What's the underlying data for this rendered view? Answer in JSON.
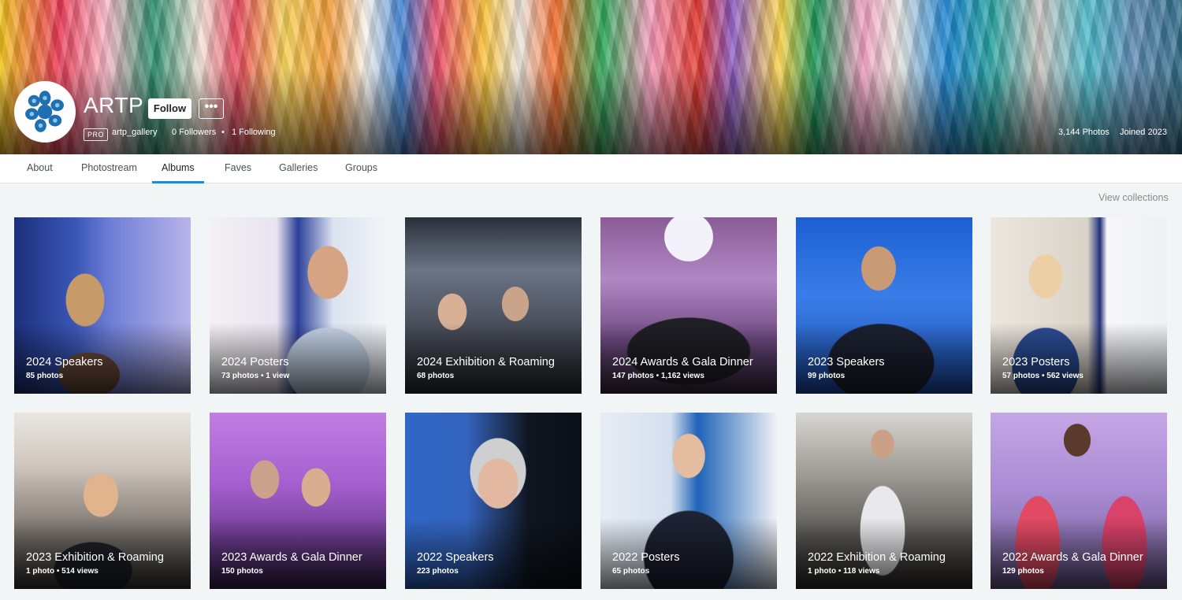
{
  "profile": {
    "name": "ARTP",
    "follow_label": "Follow",
    "more_label": "•••",
    "badge": "PRO",
    "username": "artp_gallery",
    "followers": "0 Followers",
    "separator": "•",
    "following": "1 Following",
    "photos_count": "3,144 Photos",
    "joined": "Joined 2023"
  },
  "tabs": [
    {
      "label": "About"
    },
    {
      "label": "Photostream"
    },
    {
      "label": "Albums",
      "active": true
    },
    {
      "label": "Faves"
    },
    {
      "label": "Galleries"
    },
    {
      "label": "Groups"
    }
  ],
  "view_collections": "View collections",
  "albums": [
    {
      "title": "2024 Speakers",
      "stats": "85 photos"
    },
    {
      "title": "2024 Posters",
      "stats": "73 photos  •  1 view"
    },
    {
      "title": "2024 Exhibition & Roaming",
      "stats": "68 photos"
    },
    {
      "title": "2024 Awards & Gala Dinner",
      "stats": "147 photos  •  1,162 views"
    },
    {
      "title": "2023 Speakers",
      "stats": "99 photos"
    },
    {
      "title": "2023 Posters",
      "stats": "57 photos  •  562 views"
    },
    {
      "title": "2023 Exhibition & Roaming",
      "stats": "1 photo  •  514 views"
    },
    {
      "title": "2023 Awards & Gala Dinner",
      "stats": "150 photos"
    },
    {
      "title": "2022 Speakers",
      "stats": "223 photos"
    },
    {
      "title": "2022 Posters",
      "stats": "65 photos"
    },
    {
      "title": "2022 Exhibition & Roaming",
      "stats": "1 photo  •  118 views"
    },
    {
      "title": "2022 Awards & Gala Dinner",
      "stats": "129 photos"
    }
  ],
  "colors": {
    "accent": "#128fdc",
    "tab_text": "#4b5057",
    "page_bg": "#f2f5f6",
    "logo_blue": "#1f6fb2"
  },
  "icons": {
    "avatar": "artp-logo-icon",
    "more": "more-dots-icon"
  }
}
